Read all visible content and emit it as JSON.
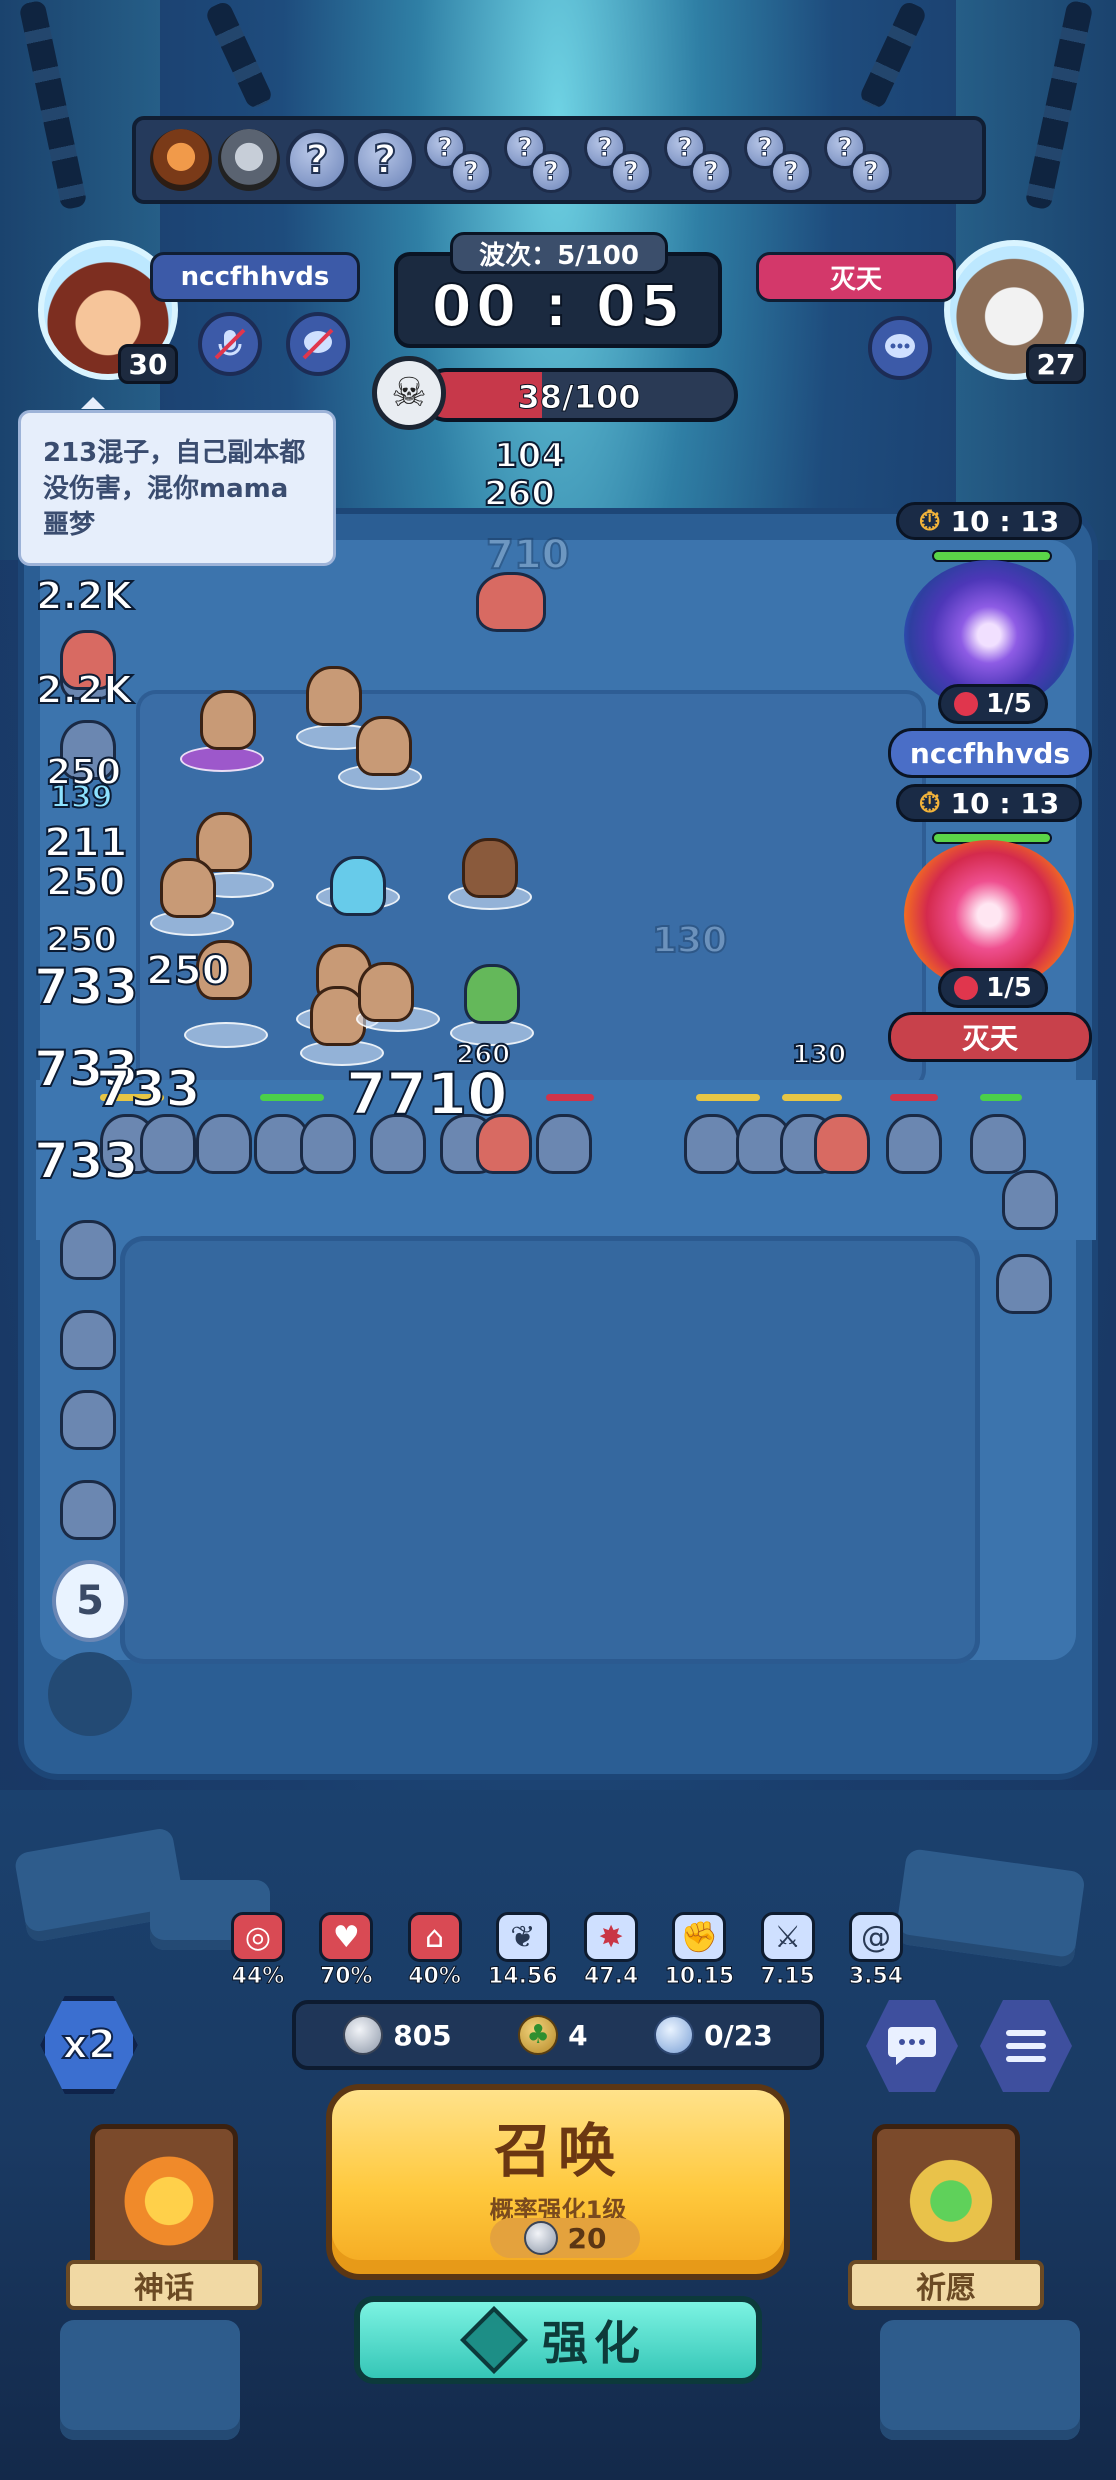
{
  "hero_bar": {
    "slots": [
      "?",
      "?",
      "?",
      "?",
      "?",
      "?",
      "?",
      "?",
      "?",
      "?",
      "?",
      "?",
      "?",
      "?"
    ]
  },
  "player_left": {
    "name": "nccfhhvds",
    "level": "30"
  },
  "player_right": {
    "name": "灭天",
    "level": "27"
  },
  "wave": {
    "label": "波次：5/100",
    "timer": "00 : 05"
  },
  "kills": {
    "text": "38/100",
    "fraction": 0.38
  },
  "chat": {
    "message": "213混子，自己副本都没伤害，混你mama噩梦"
  },
  "damage_numbers": [
    "104",
    "260",
    "710",
    "2.2K",
    "2.2K",
    "250",
    "139",
    "211",
    "250",
    "250",
    "250",
    "733",
    "733",
    "733",
    "733",
    "7710",
    "260",
    "130",
    "130"
  ],
  "portals": [
    {
      "time": "10 : 13",
      "count": "1/5",
      "owner": "nccfhhvds"
    },
    {
      "time": "10 : 13",
      "count": "1/5",
      "owner": "灭天"
    }
  ],
  "badge_count": "5",
  "stats": [
    {
      "icon": "target-icon",
      "value": "44%"
    },
    {
      "icon": "heart-icon",
      "value": "70%"
    },
    {
      "icon": "house-icon",
      "value": "40%"
    },
    {
      "icon": "wing-icon",
      "value": "14.56"
    },
    {
      "icon": "burst-icon",
      "value": "47.4"
    },
    {
      "icon": "fist-icon",
      "value": "10.15"
    },
    {
      "icon": "sword-icon",
      "value": "7.15"
    },
    {
      "icon": "swirl-icon",
      "value": "3.54"
    }
  ],
  "currency": {
    "silver": "805",
    "clover": "4",
    "units": "0/23"
  },
  "speed": {
    "label": "x2"
  },
  "summon": {
    "title": "召唤",
    "subtitle": "概率强化1级",
    "cost": "20"
  },
  "enhance": {
    "label": "强化"
  },
  "myth": {
    "label": "神话"
  },
  "wish": {
    "label": "祈愿"
  }
}
